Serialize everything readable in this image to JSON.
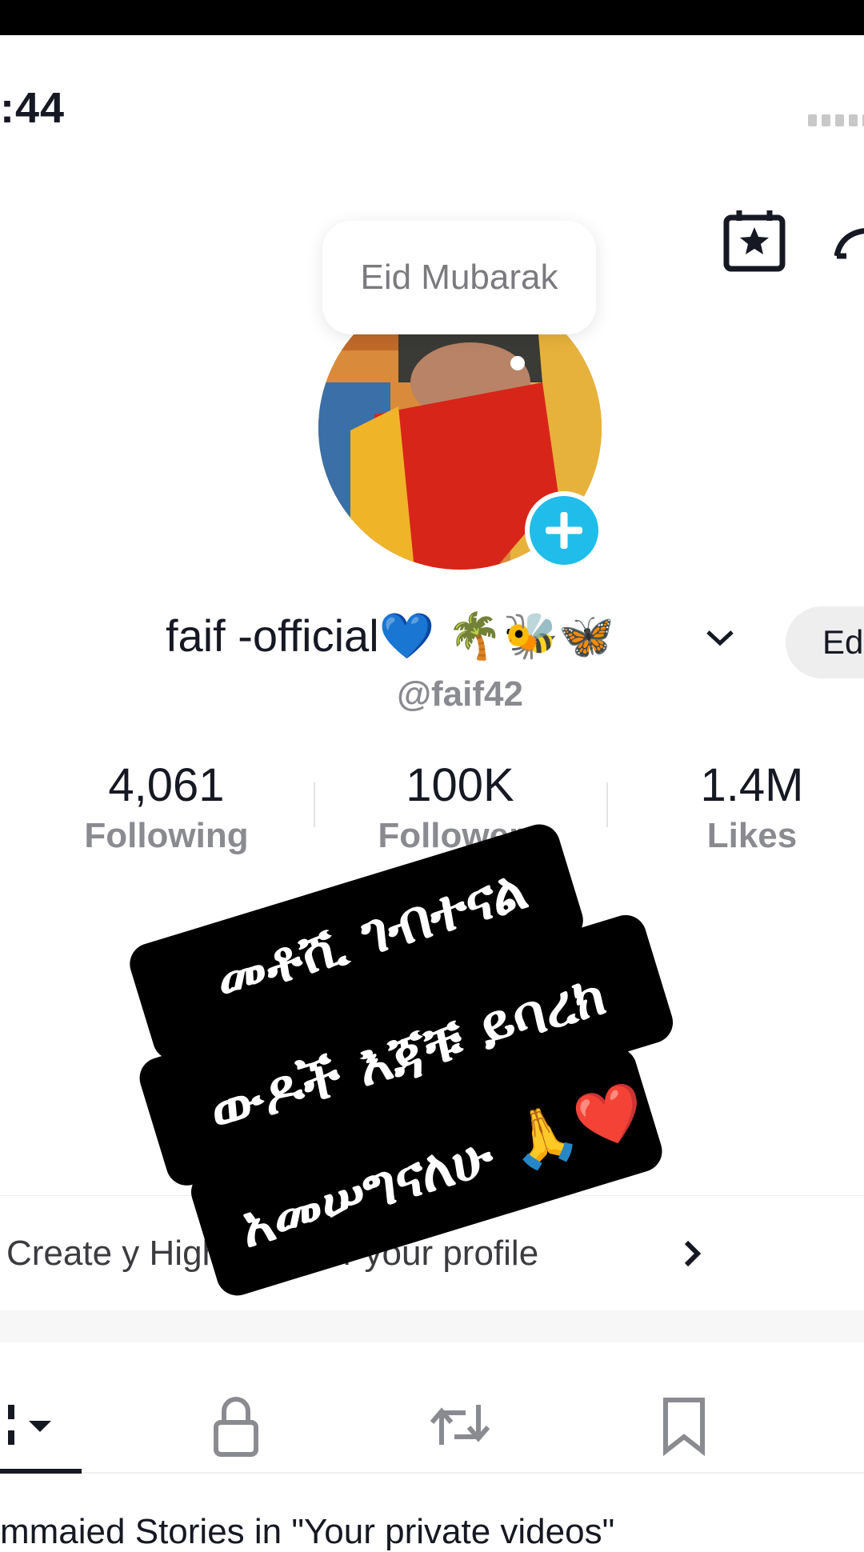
{
  "status_bar": {
    "time": ":44"
  },
  "story_bubble": {
    "text": "Eid Mubarak"
  },
  "profile": {
    "display_name": "faif -official💙 🌴🐝🦋",
    "username": "@faif42",
    "edit_label": "Ed",
    "bio": "❤️"
  },
  "stats": [
    {
      "value": "4,061",
      "label": "Following"
    },
    {
      "value": "100K",
      "label": "Followers"
    },
    {
      "value": "1.4M",
      "label": "Likes"
    }
  ],
  "highlights": {
    "text": "Create      y Highlights for your profile"
  },
  "overlay_caption": {
    "line1": "መቶሺ ገብተናል",
    "line2": "ውዶች እጃቹ ይባረክ",
    "line3": "አመሠግናለሁ 🙏❤️"
  },
  "tabs": [
    "videos-grid",
    "private",
    "reposts",
    "saved"
  ],
  "bottom_text": {
    "text": "      mmaied Stories in \"Your private videos\""
  },
  "colors": {
    "accent": "#20bdea",
    "muted": "#8a8b91",
    "text": "#161823"
  }
}
